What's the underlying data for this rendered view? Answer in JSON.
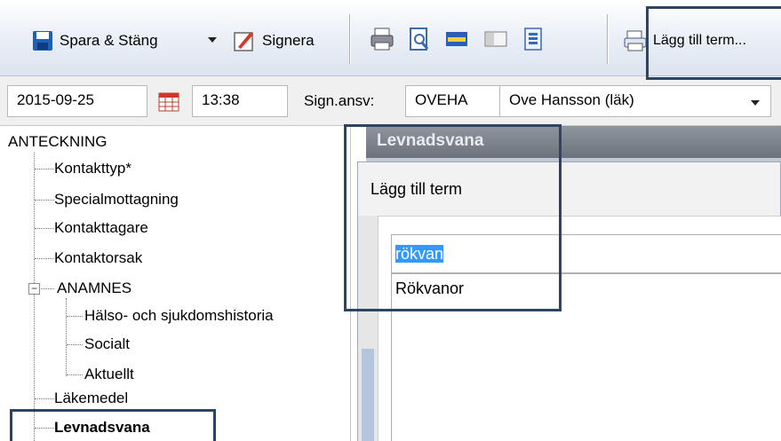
{
  "toolbar": {
    "save_close_label": "Spara & Stäng",
    "sign_label": "Signera",
    "add_term_label": "Lägg till term..."
  },
  "header_row": {
    "date_value": "2015-09-25",
    "time_value": "13:38",
    "sign_resp_label": "Sign.ansv:",
    "sign_code_value": "OVEHA",
    "sign_name_value": "Ove Hansson (läk)"
  },
  "tree": {
    "root": "ANTECKNING",
    "items": [
      {
        "label": "Kontakttyp*"
      },
      {
        "label": "Specialmottagning"
      },
      {
        "label": "Kontakttagare"
      },
      {
        "label": "Kontaktorsak"
      },
      {
        "label": "ANAMNES"
      },
      {
        "label": "Hälso- och sjukdomshistoria"
      },
      {
        "label": "Socialt"
      },
      {
        "label": "Aktuellt"
      },
      {
        "label": "Läkemedel"
      },
      {
        "label": "Levnadsvana"
      }
    ]
  },
  "panel": {
    "title": "Levnadsvana"
  },
  "dialog": {
    "title": "Lägg till term",
    "search_value": "rökvan",
    "results": [
      "Rökvanor"
    ]
  },
  "colors": {
    "highlight_border": "#2d4565",
    "selection": "#3399ff",
    "panel_title_bg": "#7d838b"
  }
}
